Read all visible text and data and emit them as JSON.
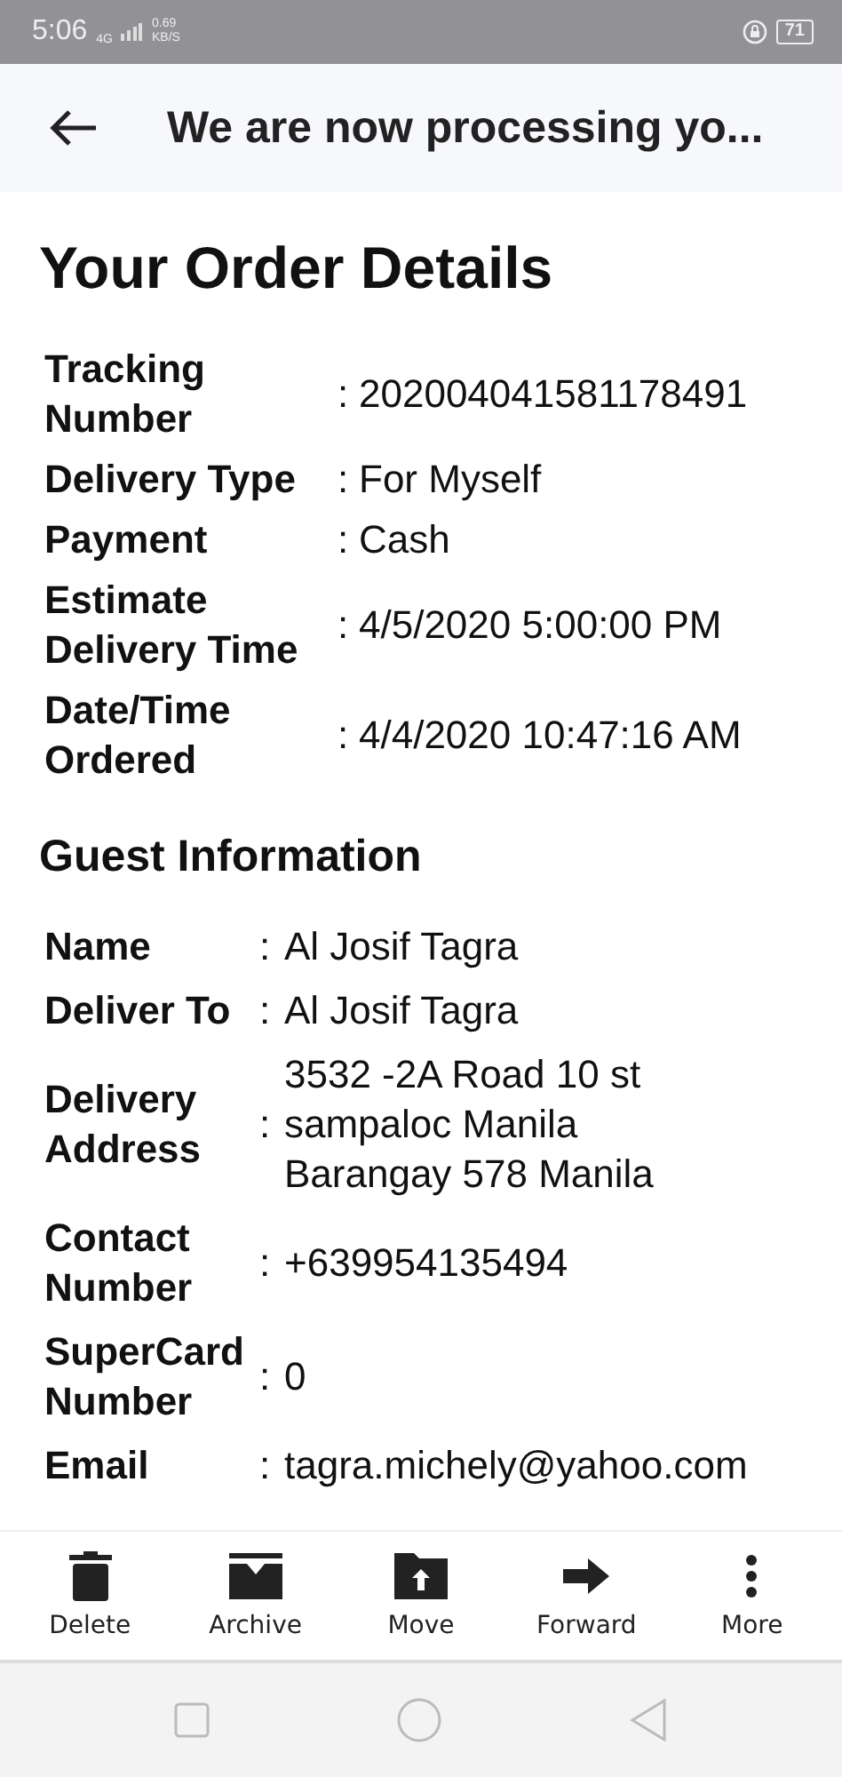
{
  "status_bar": {
    "time": "5:06",
    "network": "4G",
    "speed": "0.69",
    "speed_unit": "KB/S",
    "battery": "71"
  },
  "header": {
    "title": "We are now processing yo..."
  },
  "order": {
    "title": "Your Order Details",
    "rows": [
      {
        "label": "Tracking Number",
        "separator": ":",
        "value": [
          "202004041581178491"
        ]
      },
      {
        "label": "Delivery Type",
        "separator": ":",
        "value": [
          "For Myself"
        ]
      },
      {
        "label": "Payment",
        "separator": ":",
        "value": [
          "Cash"
        ]
      },
      {
        "label": "Estimate Delivery Time",
        "separator": ":",
        "value": [
          "4/5/2020 5:00:00 PM"
        ]
      },
      {
        "label": "Date/Time Ordered",
        "separator": ":",
        "value": [
          "4/4/2020 10:47:16 AM"
        ]
      }
    ]
  },
  "guest": {
    "title": "Guest Information",
    "rows": [
      {
        "label": "Name",
        "separator": ":",
        "value": [
          "Al Josif Tagra"
        ]
      },
      {
        "label": "Deliver To",
        "separator": ":",
        "value": [
          "Al Josif Tagra"
        ]
      },
      {
        "label": "Delivery Address",
        "separator": ":",
        "value": [
          "3532 -2A Road 10 st",
          "sampaloc Manila",
          "Barangay 578 Manila"
        ]
      },
      {
        "label": "Contact Number",
        "separator": ":",
        "value": [
          "+639954135494"
        ]
      },
      {
        "label": "SuperCard Number",
        "separator": ":",
        "value": [
          "0"
        ]
      },
      {
        "label": "Email",
        "separator": ":",
        "value": [
          "tagra.michely@yahoo.com"
        ]
      }
    ]
  },
  "toolbar": [
    {
      "kind": "delete",
      "label": "Delete"
    },
    {
      "kind": "archive",
      "label": "Archive"
    },
    {
      "kind": "move",
      "label": "Move"
    },
    {
      "kind": "forward",
      "label": "Forward"
    },
    {
      "kind": "more",
      "label": "More"
    }
  ]
}
